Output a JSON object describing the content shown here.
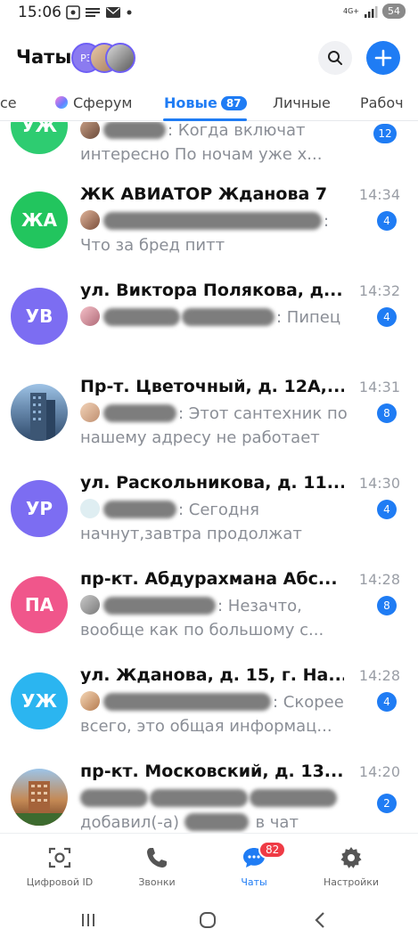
{
  "status_bar": {
    "time": "15:06",
    "network": "4G+",
    "battery": "54",
    "icons": [
      "screenshot-icon",
      "notes-icon",
      "mail-icon",
      "dot-icon",
      "signal-icon",
      "battery-icon"
    ]
  },
  "header": {
    "title": "Чаты",
    "stack_initials": "РЗ",
    "icons": [
      "search-icon",
      "plus-icon"
    ]
  },
  "tabs": [
    {
      "label": "се"
    },
    {
      "label": "Сферум"
    },
    {
      "label": "Новые",
      "badge": "87",
      "active": true
    },
    {
      "label": "Личные"
    },
    {
      "label": "Рабоч"
    }
  ],
  "chats": [
    {
      "initials": "УЖ",
      "color": "#2ecc71",
      "name": "",
      "time": "",
      "preview_line1": ": Когда включат",
      "preview_line2": "интересно По ночам уже х...",
      "badge": "12"
    },
    {
      "initials": "ЖА",
      "color": "#22c55e",
      "name": "ЖК АВИАТОР Жданова 7",
      "time": "14:34",
      "preview_line1": ":",
      "preview_line2": "Что за бред питт",
      "badge": "4"
    },
    {
      "initials": "УВ",
      "color": "#7c6df2",
      "name": "ул. Виктора Полякова, д....",
      "time": "14:32",
      "preview_line1": ": Пипец",
      "preview_line2": "",
      "badge": "4"
    },
    {
      "initials": "",
      "color": "#5b7fa6",
      "name": "Пр-т. Цветочный, д. 12А,...",
      "time": "14:31",
      "preview_line1": ": Этот сантехник по",
      "preview_line2": "нашему адресу не работает",
      "badge": "8"
    },
    {
      "initials": "УР",
      "color": "#7c6df2",
      "name": "ул. Раскольникова, д. 11...",
      "time": "14:30",
      "preview_line1": ": Сегодня",
      "preview_line2": "начнут,завтра продолжат",
      "badge": "4"
    },
    {
      "initials": "ПА",
      "color": "#f0568b",
      "name": "пр-кт. Абдурахмана Абс...",
      "time": "14:28",
      "preview_line1": ": Незачто,",
      "preview_line2": "вообще как по большому с...",
      "badge": "8"
    },
    {
      "initials": "УЖ",
      "color": "#2bb5f0",
      "name": "ул. Жданова, д. 15, г. На...",
      "time": "14:28",
      "preview_line1": ": Скорее",
      "preview_line2": "всего, это общая информац...",
      "badge": "4"
    },
    {
      "initials": "",
      "color": "#a0643a",
      "name": "пр-кт. Московский, д. 13...",
      "time": "14:20",
      "preview_line1": "",
      "preview_line2_a": "добавил(-а)",
      "preview_line2_b": "в чат",
      "badge": "2"
    }
  ],
  "bottom_nav": [
    {
      "label": "Цифровой ID",
      "icon": "digital-id-icon"
    },
    {
      "label": "Звонки",
      "icon": "phone-icon"
    },
    {
      "label": "Чаты",
      "icon": "chat-icon",
      "badge": "82",
      "active": true
    },
    {
      "label": "Настройки",
      "icon": "gear-icon"
    }
  ],
  "system_nav": [
    "recents-icon",
    "home-icon",
    "back-icon"
  ],
  "colors": {
    "accent": "#1f7cf4",
    "badge_red": "#ef3b45"
  }
}
